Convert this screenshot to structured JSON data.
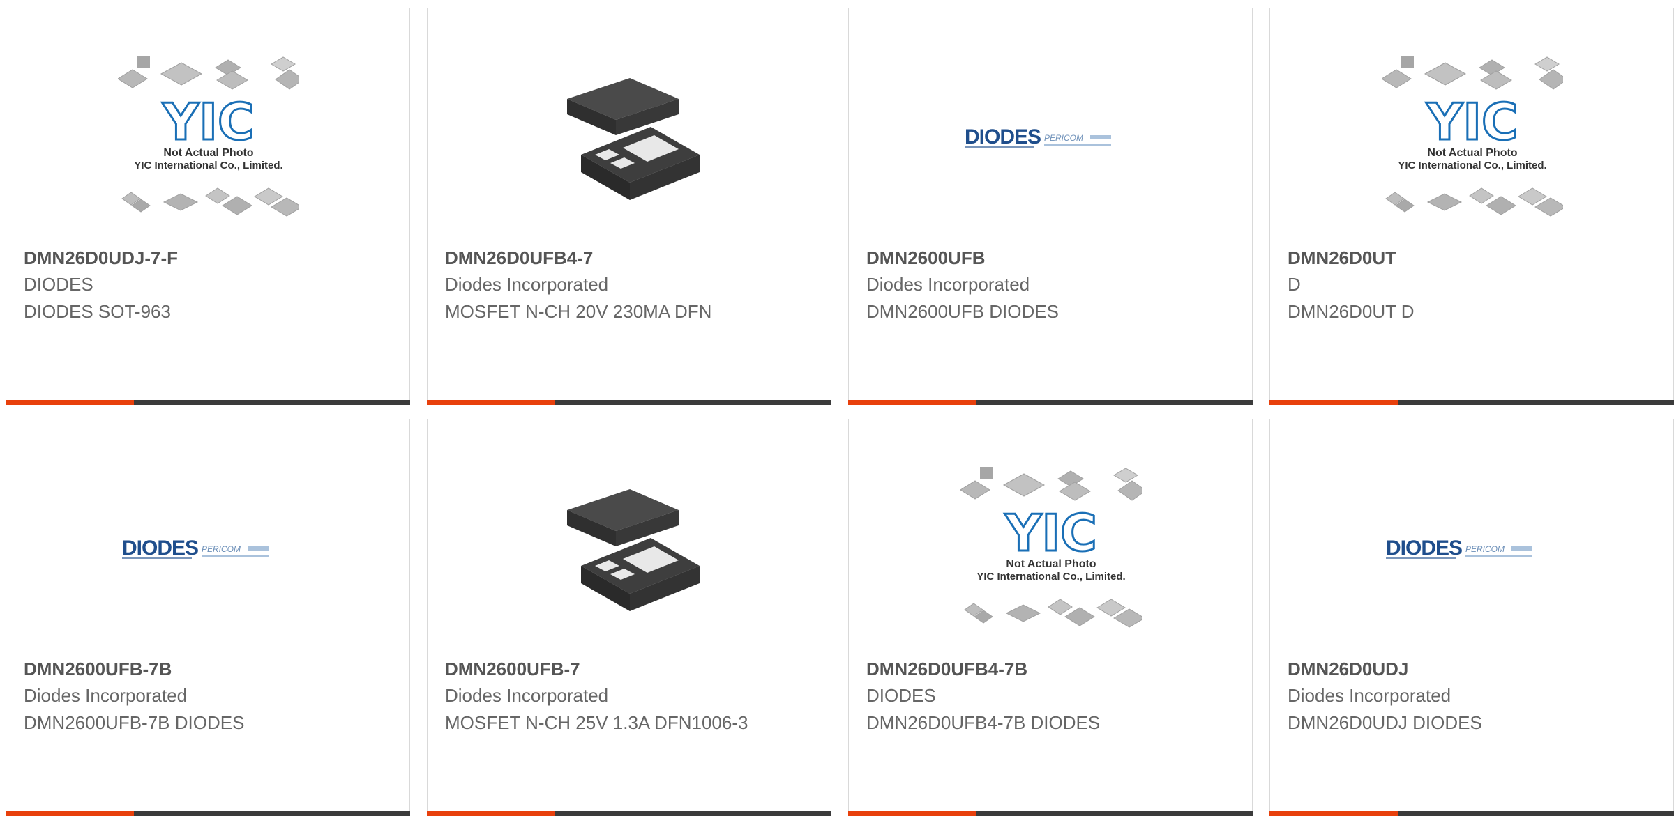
{
  "colors": {
    "accent": "#e8400c",
    "bar": "#3b3b3b",
    "title": "#555555",
    "text": "#666666",
    "border": "#d9d9d9",
    "diodes_brand": "#1f4e8c",
    "yic_logo": "#1a6fb6"
  },
  "products": [
    {
      "part_number": "DMN26D0UDJ-7-F",
      "manufacturer": "DIODES",
      "description": "DIODES SOT-963",
      "image": {
        "kind": "yic-placeholder",
        "line1": "Not Actual Photo",
        "line2": "YIC International Co., Limited."
      }
    },
    {
      "part_number": "DMN26D0UFB4-7",
      "manufacturer": "Diodes Incorporated",
      "description": "MOSFET N-CH 20V 230MA DFN",
      "image": {
        "kind": "dfn-package-photo"
      }
    },
    {
      "part_number": "DMN2600UFB",
      "manufacturer": "Diodes Incorporated",
      "description": "DMN2600UFB DIODES",
      "image": {
        "kind": "diodes-pericom-logo",
        "brand": "DIODES",
        "partner": "PERICOM"
      }
    },
    {
      "part_number": "DMN26D0UT",
      "manufacturer": "D",
      "description": "DMN26D0UT D",
      "image": {
        "kind": "yic-placeholder",
        "line1": "Not Actual Photo",
        "line2": "YIC International Co., Limited."
      }
    },
    {
      "part_number": "DMN2600UFB-7B",
      "manufacturer": "Diodes Incorporated",
      "description": "DMN2600UFB-7B DIODES",
      "image": {
        "kind": "diodes-pericom-logo",
        "brand": "DIODES",
        "partner": "PERICOM"
      }
    },
    {
      "part_number": "DMN2600UFB-7",
      "manufacturer": "Diodes Incorporated",
      "description": "MOSFET N-CH 25V 1.3A DFN1006-3",
      "image": {
        "kind": "dfn-package-photo"
      }
    },
    {
      "part_number": "DMN26D0UFB4-7B",
      "manufacturer": "DIODES",
      "description": "DMN26D0UFB4-7B DIODES",
      "image": {
        "kind": "yic-placeholder",
        "line1": "Not Actual Photo",
        "line2": "YIC International Co., Limited."
      }
    },
    {
      "part_number": "DMN26D0UDJ",
      "manufacturer": "Diodes Incorporated",
      "description": "DMN26D0UDJ DIODES",
      "image": {
        "kind": "diodes-pericom-logo",
        "brand": "DIODES",
        "partner": "PERICOM"
      }
    }
  ]
}
